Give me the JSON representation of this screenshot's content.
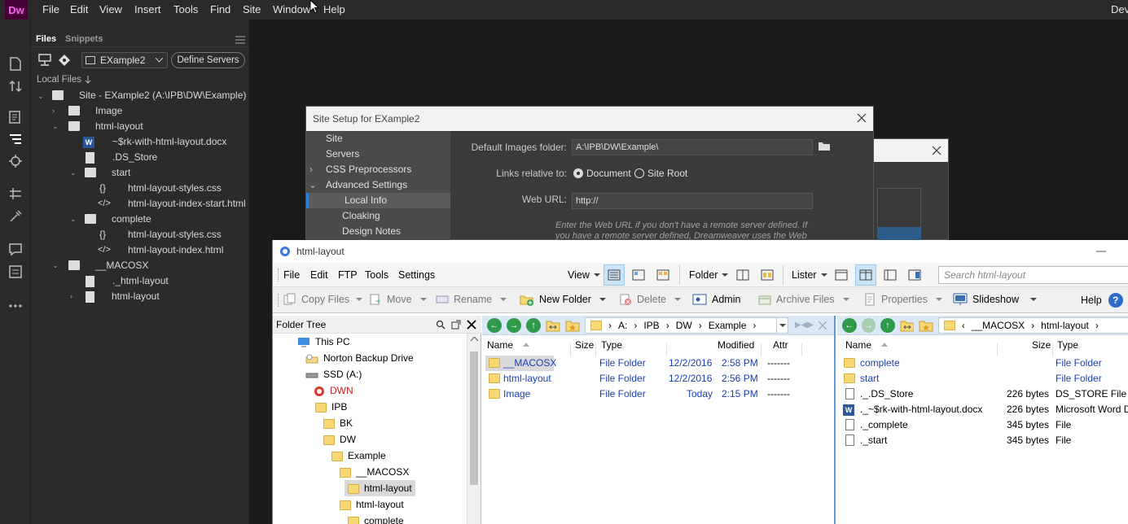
{
  "dw": {
    "logo": "Dw",
    "menu": [
      "File",
      "Edit",
      "View",
      "Insert",
      "Tools",
      "Find",
      "Site",
      "Window",
      "Help"
    ],
    "right_label": "Dev",
    "panel": {
      "tabs": [
        "Files",
        "Snippets"
      ],
      "site_select": "EXample2",
      "define_servers": "Define Servers",
      "local_files": "Local Files",
      "tree": [
        {
          "label": "Site - EXample2 (A:\\IPB\\DW\\Example)",
          "type": "site"
        },
        {
          "label": "Image",
          "type": "folder"
        },
        {
          "label": "html-layout",
          "type": "folder"
        },
        {
          "label": "~$rk-with-html-layout.docx",
          "type": "word"
        },
        {
          "label": ".DS_Store",
          "type": "file"
        },
        {
          "label": "start",
          "type": "folder"
        },
        {
          "label": "html-layout-styles.css",
          "type": "css"
        },
        {
          "label": "html-layout-index-start.html",
          "type": "html"
        },
        {
          "label": "complete",
          "type": "folder"
        },
        {
          "label": "html-layout-styles.css",
          "type": "css"
        },
        {
          "label": "html-layout-index.html",
          "type": "html"
        },
        {
          "label": "__MACOSX",
          "type": "folder"
        },
        {
          "label": "._html-layout",
          "type": "file"
        },
        {
          "label": "html-layout",
          "type": "file"
        }
      ]
    }
  },
  "site_setup": {
    "title": "Site Setup for EXample2",
    "sidebar": [
      "Site",
      "Servers",
      "CSS Preprocessors",
      "Advanced Settings",
      "Local Info",
      "Cloaking",
      "Design Notes"
    ],
    "default_images_label": "Default Images folder:",
    "default_images_value": "A:\\IPB\\DW\\Example\\",
    "links_label": "Links relative to:",
    "links_options": [
      "Document",
      "Site Root"
    ],
    "web_url_label": "Web URL:",
    "web_url_value": "http://",
    "hint_line1": "Enter the Web URL if you don't have a remote server defined. If",
    "hint_line2": "you have a remote server defined, Dreamweaver uses the Web"
  },
  "explorer": {
    "title": "html-layout",
    "menu": [
      "File",
      "Edit",
      "FTP",
      "Tools",
      "Settings"
    ],
    "menu_right": {
      "view": "View",
      "folder": "Folder",
      "lister": "Lister"
    },
    "search_placeholder": "Search html-layout",
    "toolbar": {
      "copy_files": "Copy Files",
      "move": "Move",
      "rename": "Rename",
      "new_folder": "New Folder",
      "delete": "Delete",
      "admin": "Admin",
      "archive_files": "Archive Files",
      "properties": "Properties",
      "slideshow": "Slideshow",
      "help": "Help"
    },
    "folder_tree": {
      "header": "Folder Tree",
      "items": [
        {
          "label": "This PC",
          "icon": "pc"
        },
        {
          "label": "Norton Backup Drive",
          "icon": "drive"
        },
        {
          "label": "SSD (A:)",
          "icon": "drive"
        },
        {
          "label": "DWN",
          "icon": "special"
        },
        {
          "label": "IPB",
          "icon": "folder"
        },
        {
          "label": "BK",
          "icon": "folder"
        },
        {
          "label": "DW",
          "icon": "folder"
        },
        {
          "label": "Example",
          "icon": "folder"
        },
        {
          "label": "__MACOSX",
          "icon": "folder"
        },
        {
          "label": "html-layout",
          "icon": "folder"
        },
        {
          "label": "html-layout",
          "icon": "folder"
        },
        {
          "label": "complete",
          "icon": "folder"
        }
      ]
    },
    "pane_a": {
      "breadcrumb": [
        "A:",
        "IPB",
        "DW",
        "Example"
      ],
      "columns": [
        "Name",
        "Size",
        "Type",
        "Modified",
        "Attr"
      ],
      "rows": [
        {
          "name": "__MACOSX",
          "size": "",
          "type": "File Folder",
          "date": "12/2/2016",
          "time": "2:58 PM",
          "attr": "-------"
        },
        {
          "name": "html-layout",
          "size": "",
          "type": "File Folder",
          "date": "12/2/2016",
          "time": "2:56 PM",
          "attr": "-------"
        },
        {
          "name": "Image",
          "size": "",
          "type": "File Folder",
          "date": "Today",
          "time": "2:15 PM",
          "attr": "-------"
        }
      ]
    },
    "pane_b": {
      "breadcrumb": [
        "__MACOSX",
        "html-layout"
      ],
      "columns": [
        "Name",
        "Size",
        "Type"
      ],
      "rows": [
        {
          "name": "complete",
          "size": "",
          "type": "File Folder",
          "icon": "folder"
        },
        {
          "name": "start",
          "size": "",
          "type": "File Folder",
          "icon": "folder"
        },
        {
          "name": "._.DS_Store",
          "size": "226 bytes",
          "type": "DS_STORE File",
          "icon": "file"
        },
        {
          "name": "._~$rk-with-html-layout.docx",
          "size": "226 bytes",
          "type": "Microsoft Word D",
          "icon": "word"
        },
        {
          "name": "._complete",
          "size": "345 bytes",
          "type": "File",
          "icon": "file"
        },
        {
          "name": "._start",
          "size": "345 bytes",
          "type": "File",
          "icon": "file"
        }
      ]
    }
  }
}
